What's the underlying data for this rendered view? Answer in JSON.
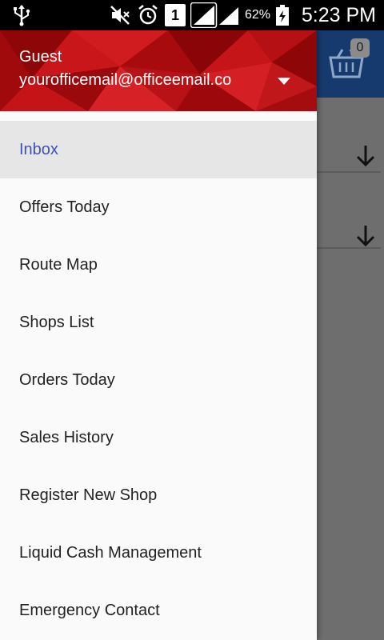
{
  "status_bar": {
    "battery_percent": "62%",
    "time": "5:23 PM",
    "sim_slot": "1",
    "icons": [
      "usb-icon",
      "mute-icon",
      "alarm-icon",
      "sim-icon",
      "signal-icon",
      "battery-icon"
    ]
  },
  "app": {
    "cart_badge": "0",
    "toolbar_color": "#173a6e"
  },
  "drawer": {
    "header": {
      "user_name": "Guest",
      "email": "yourofficemail@officeemail.co",
      "accent": "#b30f12"
    },
    "menu": [
      {
        "label": "Inbox",
        "active": true
      },
      {
        "label": "Offers Today"
      },
      {
        "label": "Route Map"
      },
      {
        "label": "Shops List"
      },
      {
        "label": "Orders Today"
      },
      {
        "label": "Sales History"
      },
      {
        "label": "Register New Shop"
      },
      {
        "label": "Liquid Cash Management"
      },
      {
        "label": "Emergency Contact"
      }
    ],
    "active_color": "#3f51b5"
  }
}
